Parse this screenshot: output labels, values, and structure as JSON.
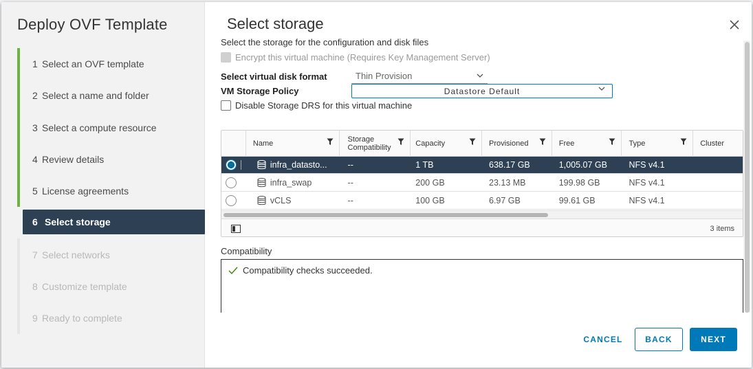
{
  "wizard": {
    "title": "Deploy OVF Template",
    "steps": [
      {
        "num": "1",
        "label": "Select an OVF template",
        "state": "done"
      },
      {
        "num": "2",
        "label": "Select a name and folder",
        "state": "done"
      },
      {
        "num": "3",
        "label": "Select a compute resource",
        "state": "done"
      },
      {
        "num": "4",
        "label": "Review details",
        "state": "done"
      },
      {
        "num": "5",
        "label": "License agreements",
        "state": "done"
      },
      {
        "num": "6",
        "label": "Select storage",
        "state": "active"
      },
      {
        "num": "7",
        "label": "Select networks",
        "state": "todo"
      },
      {
        "num": "8",
        "label": "Customize template",
        "state": "todo"
      },
      {
        "num": "9",
        "label": "Ready to complete",
        "state": "todo"
      }
    ]
  },
  "page": {
    "title": "Select storage",
    "intro": "Select the storage for the configuration and disk files",
    "encrypt_label": "Encrypt this virtual machine (Requires Key Management Server)",
    "disk_format_label": "Select virtual disk format",
    "disk_format_value": "Thin Provision",
    "storage_policy_label": "VM Storage Policy",
    "storage_policy_value": "Datastore Default",
    "drs_label": "Disable Storage DRS for this virtual machine"
  },
  "grid": {
    "columns": [
      "Name",
      "Storage Compatibility",
      "Capacity",
      "Provisioned",
      "Free",
      "Type",
      "Cluster"
    ],
    "rows": [
      {
        "name": "infra_datasto...",
        "compat": "--",
        "capacity": "1 TB",
        "provisioned": "638.17 GB",
        "free": "1,005.07 GB",
        "type": "NFS v4.1",
        "cluster": "",
        "selected": true
      },
      {
        "name": "infra_swap",
        "compat": "--",
        "capacity": "200 GB",
        "provisioned": "23.13 MB",
        "free": "199.98 GB",
        "type": "NFS v4.1",
        "cluster": "",
        "selected": false
      },
      {
        "name": "vCLS",
        "compat": "--",
        "capacity": "100 GB",
        "provisioned": "6.97 GB",
        "free": "99.61 GB",
        "type": "NFS v4.1",
        "cluster": "",
        "selected": false
      }
    ],
    "items_count": "3 items"
  },
  "compatibility": {
    "label": "Compatibility",
    "message": "Compatibility checks succeeded."
  },
  "footer": {
    "cancel": "CANCEL",
    "back": "BACK",
    "next": "NEXT"
  },
  "colors": {
    "accent": "#0079b8",
    "selected_row": "#2d4054",
    "done_step": "#6db33f"
  }
}
